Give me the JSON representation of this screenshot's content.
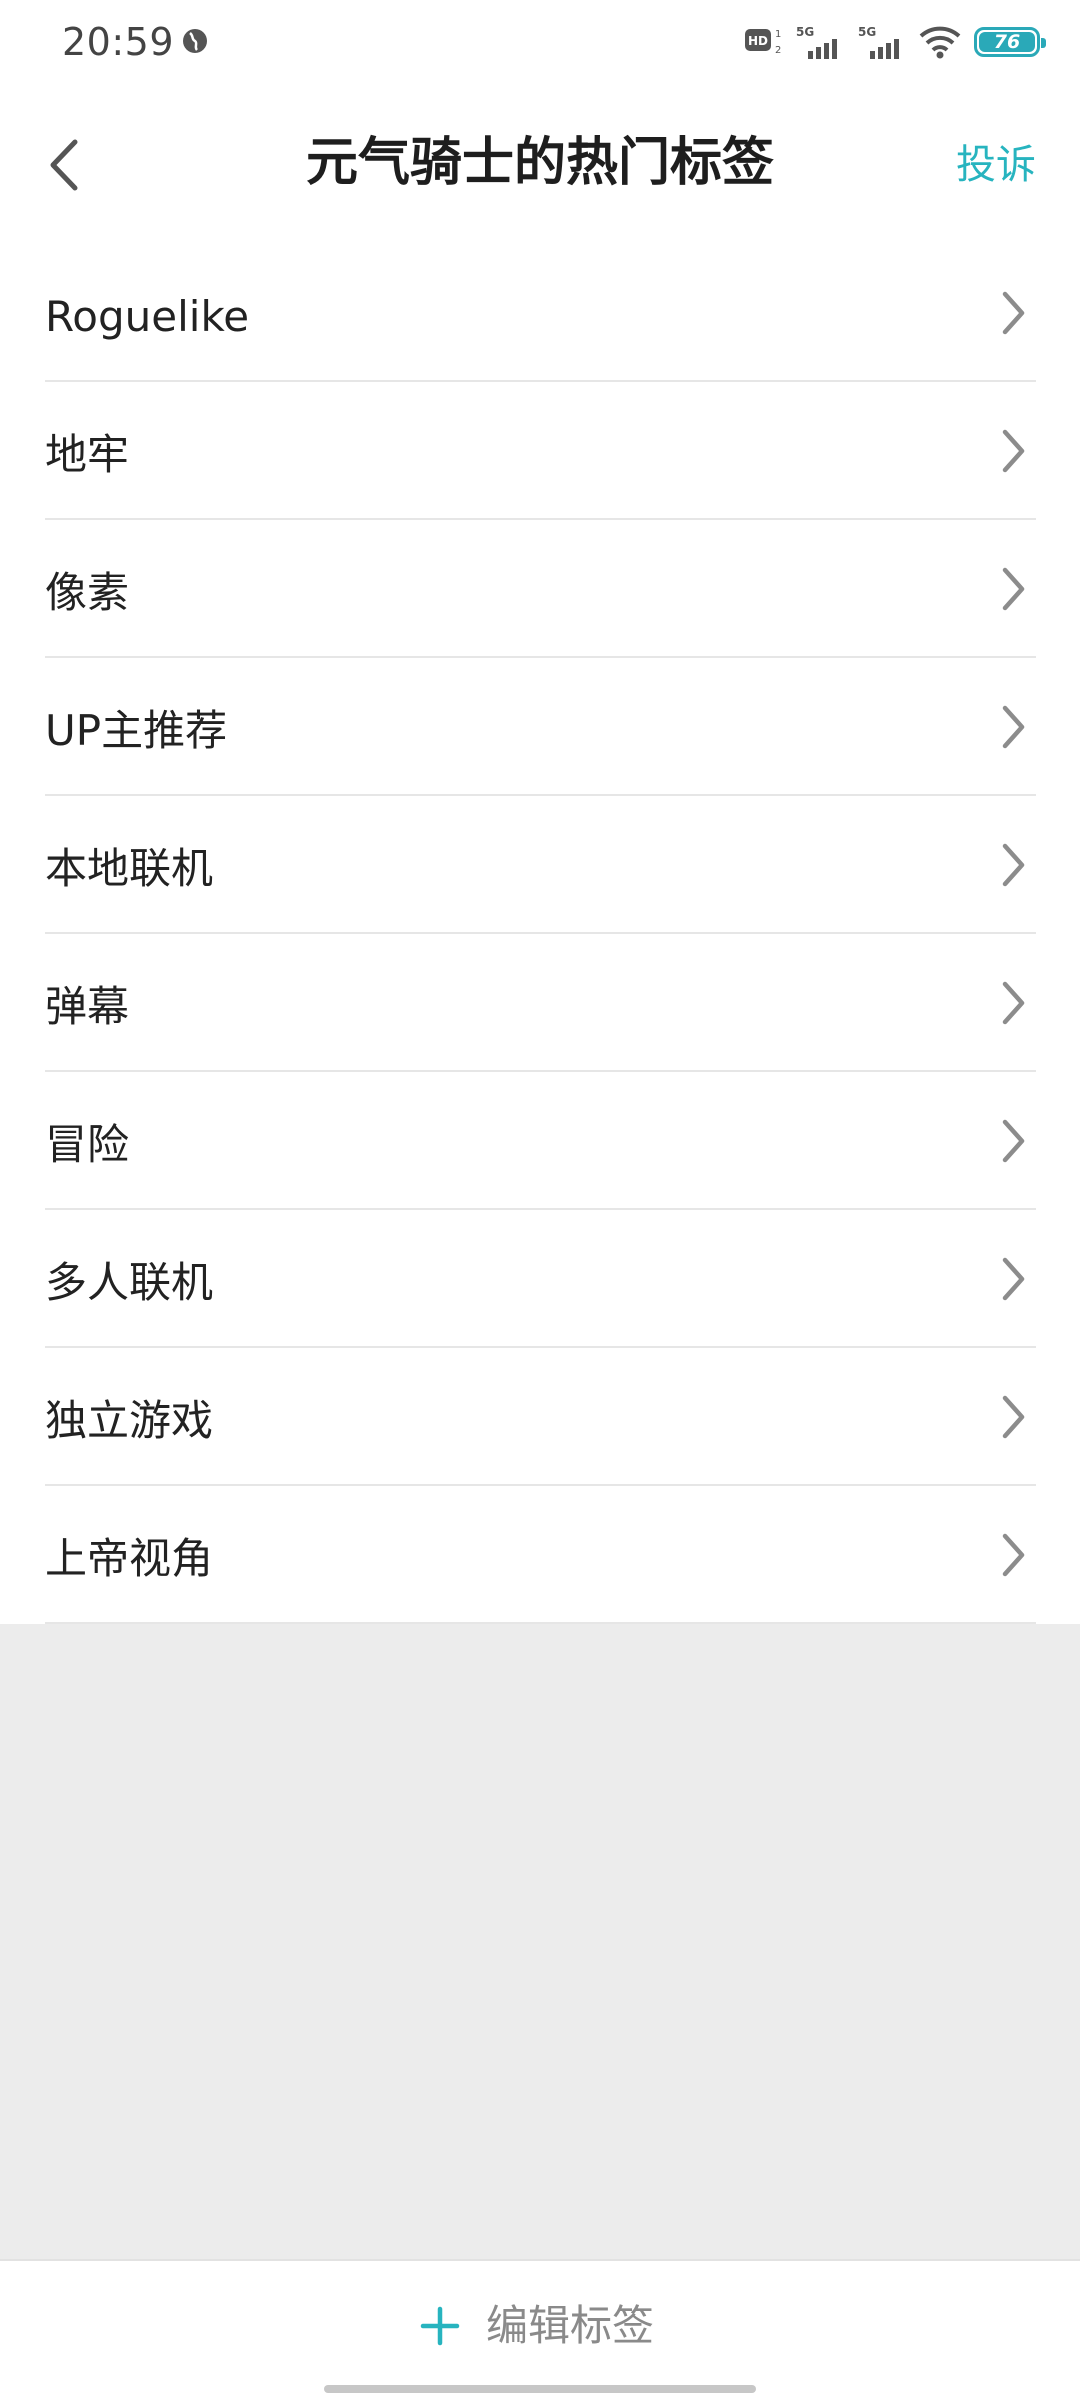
{
  "status_bar": {
    "time": "20:59",
    "hd_label": "HD",
    "network_1": "5G",
    "network_2": "5G",
    "battery": "76"
  },
  "header": {
    "title": "元气骑士的热门标签",
    "report_label": "投诉"
  },
  "tags": [
    {
      "label": "Roguelike"
    },
    {
      "label": "地牢"
    },
    {
      "label": "像素"
    },
    {
      "label": "UP主推荐"
    },
    {
      "label": "本地联机"
    },
    {
      "label": "弹幕"
    },
    {
      "label": "冒险"
    },
    {
      "label": "多人联机"
    },
    {
      "label": "独立游戏"
    },
    {
      "label": "上帝视角"
    }
  ],
  "bottom_bar": {
    "edit_label": "编辑标签"
  },
  "colors": {
    "accent": "#27b4bf",
    "page_background": "#ececec",
    "divider": "#e6e6e6",
    "chevron": "#8c8c8c"
  },
  "icons": {
    "back": "chevron-left-icon",
    "row_arrow": "chevron-right-icon",
    "add": "plus-icon",
    "status": [
      "globe-icon",
      "hd-icon",
      "signal-icon",
      "signal-icon",
      "wifi-icon",
      "battery-icon"
    ]
  }
}
